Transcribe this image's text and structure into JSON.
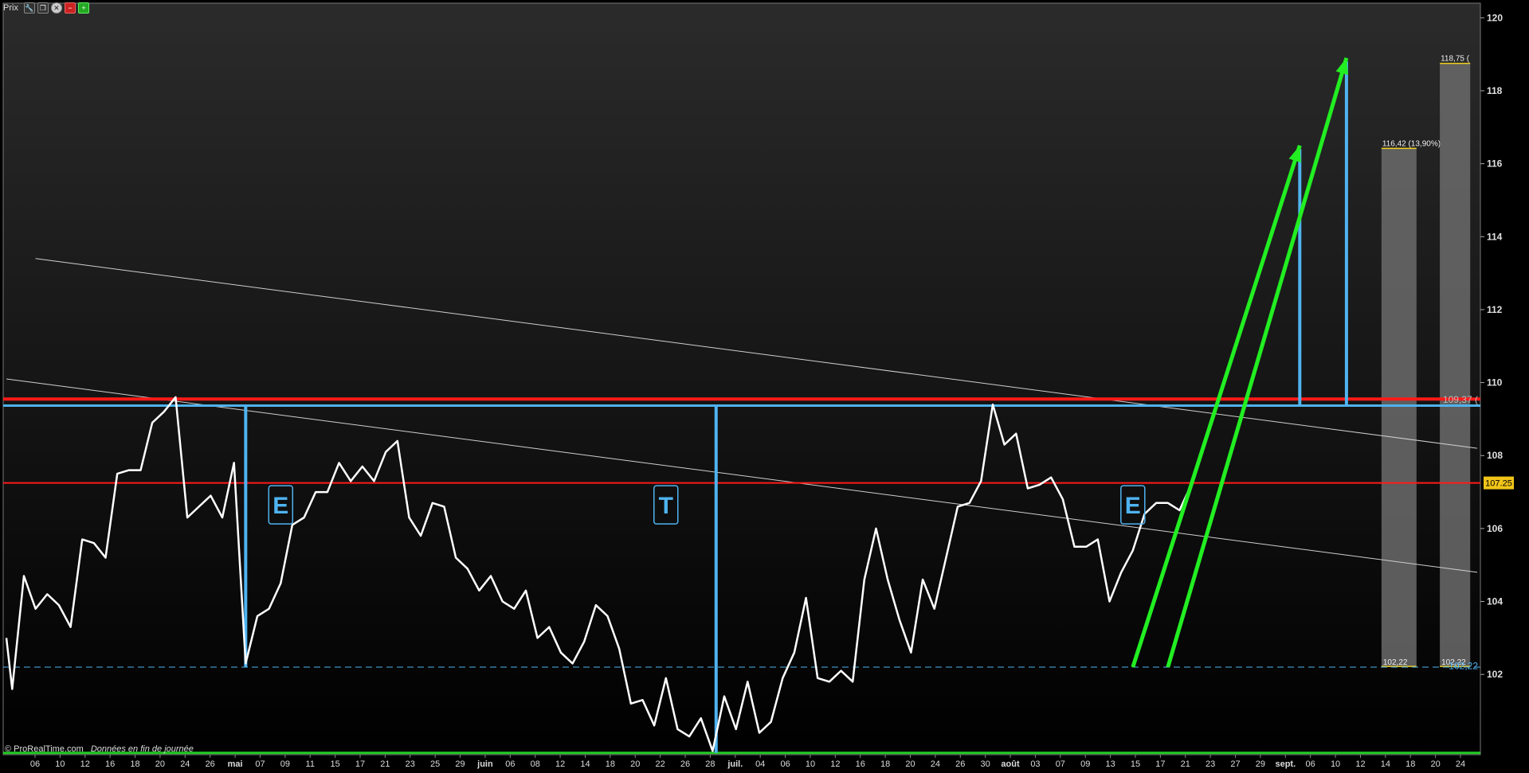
{
  "toolbar": {
    "title": "Prix",
    "buttons": [
      {
        "name": "settings-wrench-icon",
        "glyph": "🔧",
        "style": ""
      },
      {
        "name": "window-restore-icon",
        "glyph": "❐",
        "style": ""
      },
      {
        "name": "close-icon",
        "glyph": "✕",
        "style": "close"
      },
      {
        "name": "remove-panel-icon",
        "glyph": "−",
        "style": "red"
      },
      {
        "name": "add-panel-icon",
        "glyph": "+",
        "style": "green"
      }
    ]
  },
  "footer": {
    "copyright": "© ProRealTime.com",
    "note": "Données en fin de journée"
  },
  "colors": {
    "background_top": "#2b2b2b",
    "background_bottom": "#000000",
    "price_line": "#ffffff",
    "resistance_red": "#ff1a1a",
    "neckline_blue": "#4fb3f0",
    "support_green": "#22cc22",
    "arrow_green": "#22ee22",
    "projection_bar": "#6b6b6b",
    "price_tag_bg": "#f0c419"
  },
  "chart_data": {
    "type": "line",
    "ylim": [
      99.8,
      120.4
    ],
    "yticks": [
      102,
      104,
      106,
      108,
      110,
      112,
      114,
      116,
      118,
      120
    ],
    "x_labels": [
      "06",
      "10",
      "12",
      "16",
      "18",
      "20",
      "24",
      "26",
      "mai",
      "07",
      "09",
      "11",
      "15",
      "17",
      "21",
      "23",
      "25",
      "29",
      "juin",
      "06",
      "08",
      "12",
      "14",
      "18",
      "20",
      "22",
      "26",
      "28",
      "juil.",
      "04",
      "06",
      "10",
      "12",
      "16",
      "18",
      "20",
      "24",
      "26",
      "30",
      "août",
      "03",
      "07",
      "09",
      "13",
      "15",
      "17",
      "21",
      "23",
      "27",
      "29",
      "sept.",
      "06",
      "10",
      "12",
      "14",
      "18",
      "20",
      "24"
    ],
    "x_bold": [
      "mai",
      "juin",
      "juil.",
      "août",
      "sept."
    ],
    "price_series": [
      [
        0,
        103.0
      ],
      [
        0.5,
        101.6
      ],
      [
        1.5,
        104.7
      ],
      [
        2.5,
        103.8
      ],
      [
        3.5,
        104.2
      ],
      [
        4.5,
        103.9
      ],
      [
        5.5,
        103.3
      ],
      [
        6.5,
        105.7
      ],
      [
        7.5,
        105.6
      ],
      [
        8.5,
        105.2
      ],
      [
        9.5,
        107.5
      ],
      [
        10.5,
        107.6
      ],
      [
        11.5,
        107.6
      ],
      [
        12.5,
        108.9
      ],
      [
        13.5,
        109.2
      ],
      [
        14.5,
        109.6
      ],
      [
        15.5,
        106.3
      ],
      [
        16.5,
        106.6
      ],
      [
        17.5,
        106.9
      ],
      [
        18.5,
        106.3
      ],
      [
        19.5,
        107.8
      ],
      [
        20.5,
        102.3
      ],
      [
        21.5,
        103.6
      ],
      [
        22.5,
        103.8
      ],
      [
        23.5,
        104.5
      ],
      [
        24.5,
        106.1
      ],
      [
        25.5,
        106.3
      ],
      [
        26.5,
        107.0
      ],
      [
        27.5,
        107.0
      ],
      [
        28.5,
        107.8
      ],
      [
        29.5,
        107.3
      ],
      [
        30.5,
        107.7
      ],
      [
        31.5,
        107.3
      ],
      [
        32.5,
        108.1
      ],
      [
        33.5,
        108.4
      ],
      [
        34.5,
        106.3
      ],
      [
        35.5,
        105.8
      ],
      [
        36.5,
        106.7
      ],
      [
        37.5,
        106.6
      ],
      [
        38.5,
        105.2
      ],
      [
        39.5,
        104.9
      ],
      [
        40.5,
        104.3
      ],
      [
        41.5,
        104.7
      ],
      [
        42.5,
        104.0
      ],
      [
        43.5,
        103.8
      ],
      [
        44.5,
        104.3
      ],
      [
        45.5,
        103.0
      ],
      [
        46.5,
        103.3
      ],
      [
        47.5,
        102.6
      ],
      [
        48.5,
        102.3
      ],
      [
        49.5,
        102.9
      ],
      [
        50.5,
        103.9
      ],
      [
        51.5,
        103.6
      ],
      [
        52.5,
        102.7
      ],
      [
        53.5,
        101.2
      ],
      [
        54.5,
        101.3
      ],
      [
        55.5,
        100.6
      ],
      [
        56.5,
        101.9
      ],
      [
        57.5,
        100.5
      ],
      [
        58.5,
        100.3
      ],
      [
        59.5,
        100.8
      ],
      [
        60.5,
        99.9
      ],
      [
        61.5,
        101.4
      ],
      [
        62.5,
        100.5
      ],
      [
        63.5,
        101.8
      ],
      [
        64.5,
        100.4
      ],
      [
        65.5,
        100.7
      ],
      [
        66.5,
        101.9
      ],
      [
        67.5,
        102.6
      ],
      [
        68.5,
        104.1
      ],
      [
        69.5,
        101.9
      ],
      [
        70.5,
        101.8
      ],
      [
        71.5,
        102.1
      ],
      [
        72.5,
        101.8
      ],
      [
        73.5,
        104.6
      ],
      [
        74.5,
        106.0
      ],
      [
        75.5,
        104.6
      ],
      [
        76.5,
        103.5
      ],
      [
        77.5,
        102.6
      ],
      [
        78.5,
        104.6
      ],
      [
        79.5,
        103.8
      ],
      [
        80.5,
        105.2
      ],
      [
        81.5,
        106.6
      ],
      [
        82.5,
        106.7
      ],
      [
        83.5,
        107.3
      ],
      [
        84.5,
        109.4
      ],
      [
        85.5,
        108.3
      ],
      [
        86.5,
        108.6
      ],
      [
        87.5,
        107.1
      ],
      [
        88.5,
        107.2
      ],
      [
        89.5,
        107.4
      ],
      [
        90.5,
        106.8
      ],
      [
        91.5,
        105.5
      ],
      [
        92.5,
        105.5
      ],
      [
        93.5,
        105.7
      ],
      [
        94.5,
        104.0
      ],
      [
        95.5,
        104.8
      ],
      [
        96.5,
        105.4
      ],
      [
        97.5,
        106.4
      ],
      [
        98.5,
        106.7
      ],
      [
        99.5,
        106.7
      ],
      [
        100.5,
        106.5
      ],
      [
        101.5,
        107.2
      ]
    ],
    "x_domain": [
      0,
      126
    ],
    "horizontal_levels": [
      {
        "y": 109.55,
        "color": "#ff1a1a",
        "width": 4,
        "dashed": false
      },
      {
        "y": 109.37,
        "color": "#4fb3f0",
        "width": 3,
        "dashed": false
      },
      {
        "y": 107.25,
        "color": "#ff1a1a",
        "width": 2,
        "dashed": false
      },
      {
        "y": 102.2,
        "color": "#4fb3f0",
        "width": 1,
        "dashed": true
      },
      {
        "y": 99.85,
        "color": "#22cc22",
        "width": 3,
        "dashed": false
      }
    ],
    "trendlines": [
      {
        "x1": 2.5,
        "y1": 113.4,
        "x2": 126,
        "y2": 108.2
      },
      {
        "x1": 0,
        "y1": 110.1,
        "x2": 126,
        "y2": 104.8
      }
    ],
    "vertical_markers": [
      {
        "x": 20.5,
        "y_top": 109.37,
        "y_bottom": 102.2
      },
      {
        "x": 60.8,
        "y_top": 109.37,
        "y_bottom": 99.85
      },
      {
        "x": 110.8,
        "y_top": 116.4,
        "y_bottom": 109.37
      },
      {
        "x": 114.8,
        "y_top": 118.8,
        "y_bottom": 109.37
      }
    ],
    "arrows": [
      {
        "x1": 96.5,
        "y1": 102.2,
        "x2": 110.8,
        "y2": 116.5
      },
      {
        "x1": 99.5,
        "y1": 102.2,
        "x2": 114.8,
        "y2": 118.9
      }
    ],
    "pattern_labels": [
      {
        "text": "E",
        "x": 23.5,
        "y": 106.65
      },
      {
        "text": "T",
        "x": 56.5,
        "y": 106.65
      },
      {
        "text": "E",
        "x": 96.5,
        "y": 106.65
      }
    ],
    "projection_bars": [
      {
        "x_start": 117.8,
        "x_end": 120.8,
        "y_top": 116.42,
        "y_bottom": 102.22,
        "top_label": "116,42 (13,90%)",
        "bottom_label": "102,22"
      },
      {
        "x_start": 122.8,
        "x_end": 125.4,
        "y_top": 118.75,
        "y_bottom": 102.22,
        "top_label": "118,75 (",
        "bottom_label": "102,22"
      }
    ],
    "right_labels": [
      {
        "y": 109.55,
        "text": "109,37 (",
        "color": "#bbbbbb"
      },
      {
        "y": 102.25,
        "text": "102,22",
        "color": "#4fb3f0"
      }
    ],
    "price_tag": {
      "y": 107.25,
      "text": "107.25"
    }
  }
}
